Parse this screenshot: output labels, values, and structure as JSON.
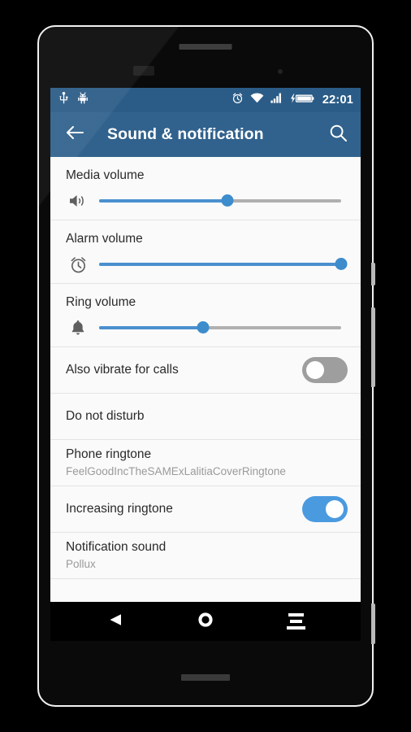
{
  "device": {
    "hardware": {
      "earpiece": "earpiece-speaker",
      "proximity_sensor": "proximity-sensor",
      "front_camera": "front-camera",
      "bottom_speaker": "bottom-speaker",
      "power_button": "power-button",
      "volume_rocker": "volume-rocker",
      "camera_button": "camera-button"
    }
  },
  "status_bar": {
    "background_color": "#2b5c87",
    "left_icons": [
      "usb-icon",
      "android-debug-icon"
    ],
    "right_icons": [
      "alarm-icon",
      "wifi-icon",
      "signal-icon",
      "battery-charging-icon"
    ],
    "clock": "22:01"
  },
  "app_bar": {
    "background_color": "#31628d",
    "back_icon": "arrow-left-icon",
    "title": "Sound & notification",
    "search_icon": "search-icon"
  },
  "settings": {
    "accent_color": "#4a9ae0",
    "slider_fill_color": "#4a90cf",
    "slider_track_color": "#b0b0b0",
    "rows": [
      {
        "type": "slider",
        "name": "media-volume",
        "title": "Media volume",
        "icon": "speaker-icon",
        "value_percent": 53
      },
      {
        "type": "slider",
        "name": "alarm-volume",
        "title": "Alarm volume",
        "icon": "alarm-clock-icon",
        "value_percent": 100
      },
      {
        "type": "slider",
        "name": "ring-volume",
        "title": "Ring volume",
        "icon": "bell-icon",
        "value_percent": 43
      },
      {
        "type": "switch",
        "name": "also-vibrate-for-calls",
        "title": "Also vibrate for calls",
        "checked": false
      },
      {
        "type": "simple",
        "name": "do-not-disturb",
        "title": "Do not disturb"
      },
      {
        "type": "two-line",
        "name": "phone-ringtone",
        "title": "Phone ringtone",
        "subtitle": "FeelGoodIncTheSAMExLalitiaCoverRingtone"
      },
      {
        "type": "switch",
        "name": "increasing-ringtone",
        "title": "Increasing ringtone",
        "checked": true
      },
      {
        "type": "two-line",
        "name": "notification-sound",
        "title": "Notification sound",
        "subtitle": "Pollux"
      }
    ]
  },
  "nav_bar": {
    "background_color": "#000000",
    "buttons": [
      {
        "name": "nav-back",
        "icon": "triangle-back-icon"
      },
      {
        "name": "nav-home",
        "icon": "circle-home-icon"
      },
      {
        "name": "nav-recents",
        "icon": "recents-lines-icon"
      }
    ]
  }
}
